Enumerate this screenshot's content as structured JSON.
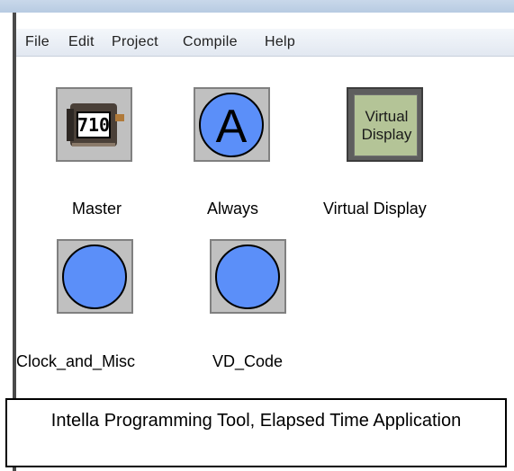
{
  "window": {
    "title": ""
  },
  "menu": [
    "File",
    "Edit",
    "Project",
    "Compile",
    "Help"
  ],
  "tiles": [
    {
      "label": "Master",
      "kind": "device",
      "display": "710"
    },
    {
      "label": "Always",
      "kind": "letter-circle",
      "letter": "A"
    },
    {
      "label": "Virtual Display",
      "kind": "virtual-display",
      "inner_text": "Virtual\nDisplay"
    },
    {
      "label": "Clock_and_Misc",
      "kind": "circle"
    },
    {
      "label": "VD_Code",
      "kind": "circle"
    }
  ],
  "caption": "Intella Programming Tool, Elapsed Time Application",
  "colors": {
    "circle_fill": "#5b8ff9",
    "tile_bg": "#c0c0c0",
    "vd_screen": "#b4c497"
  },
  "icons": [
    "plc-device-icon",
    "always-a-icon",
    "virtual-display-icon",
    "blue-circle-icon"
  ]
}
